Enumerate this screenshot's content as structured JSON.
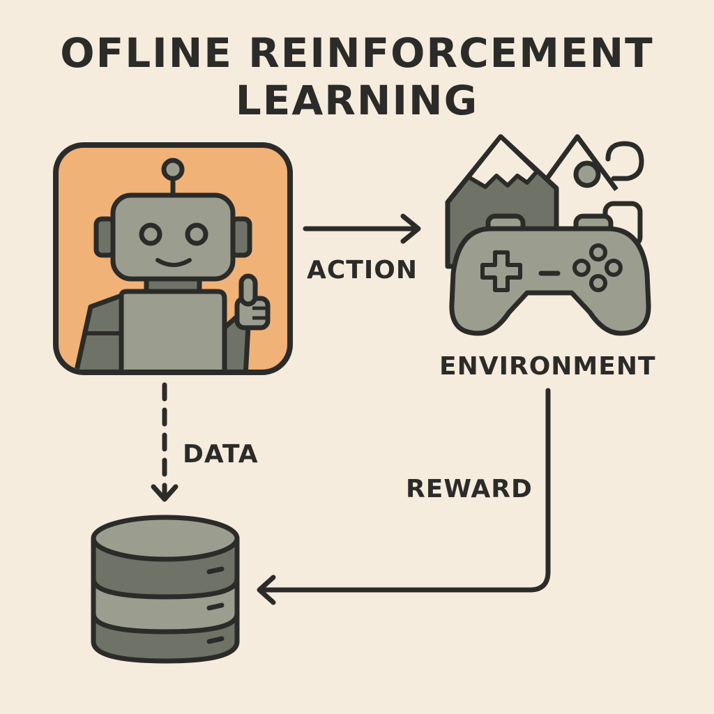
{
  "title": {
    "line1": "OFLINE REINFORCEMENT",
    "line2": "LEARNING"
  },
  "labels": {
    "action": "ACTION",
    "environment": "ENVIRONMENT",
    "data": "DATA",
    "reward": "REWARD"
  },
  "icons": {
    "agent": "robot-icon",
    "environment": "gamepad-icon",
    "scenery": "mountain-icon",
    "dataset": "database-icon"
  },
  "colors": {
    "background": "#f6ecdd",
    "agent_panel": "#f0b277",
    "icon_fill": "#9b9d8f",
    "icon_dark": "#6f7266",
    "outline": "#2b2b29"
  }
}
